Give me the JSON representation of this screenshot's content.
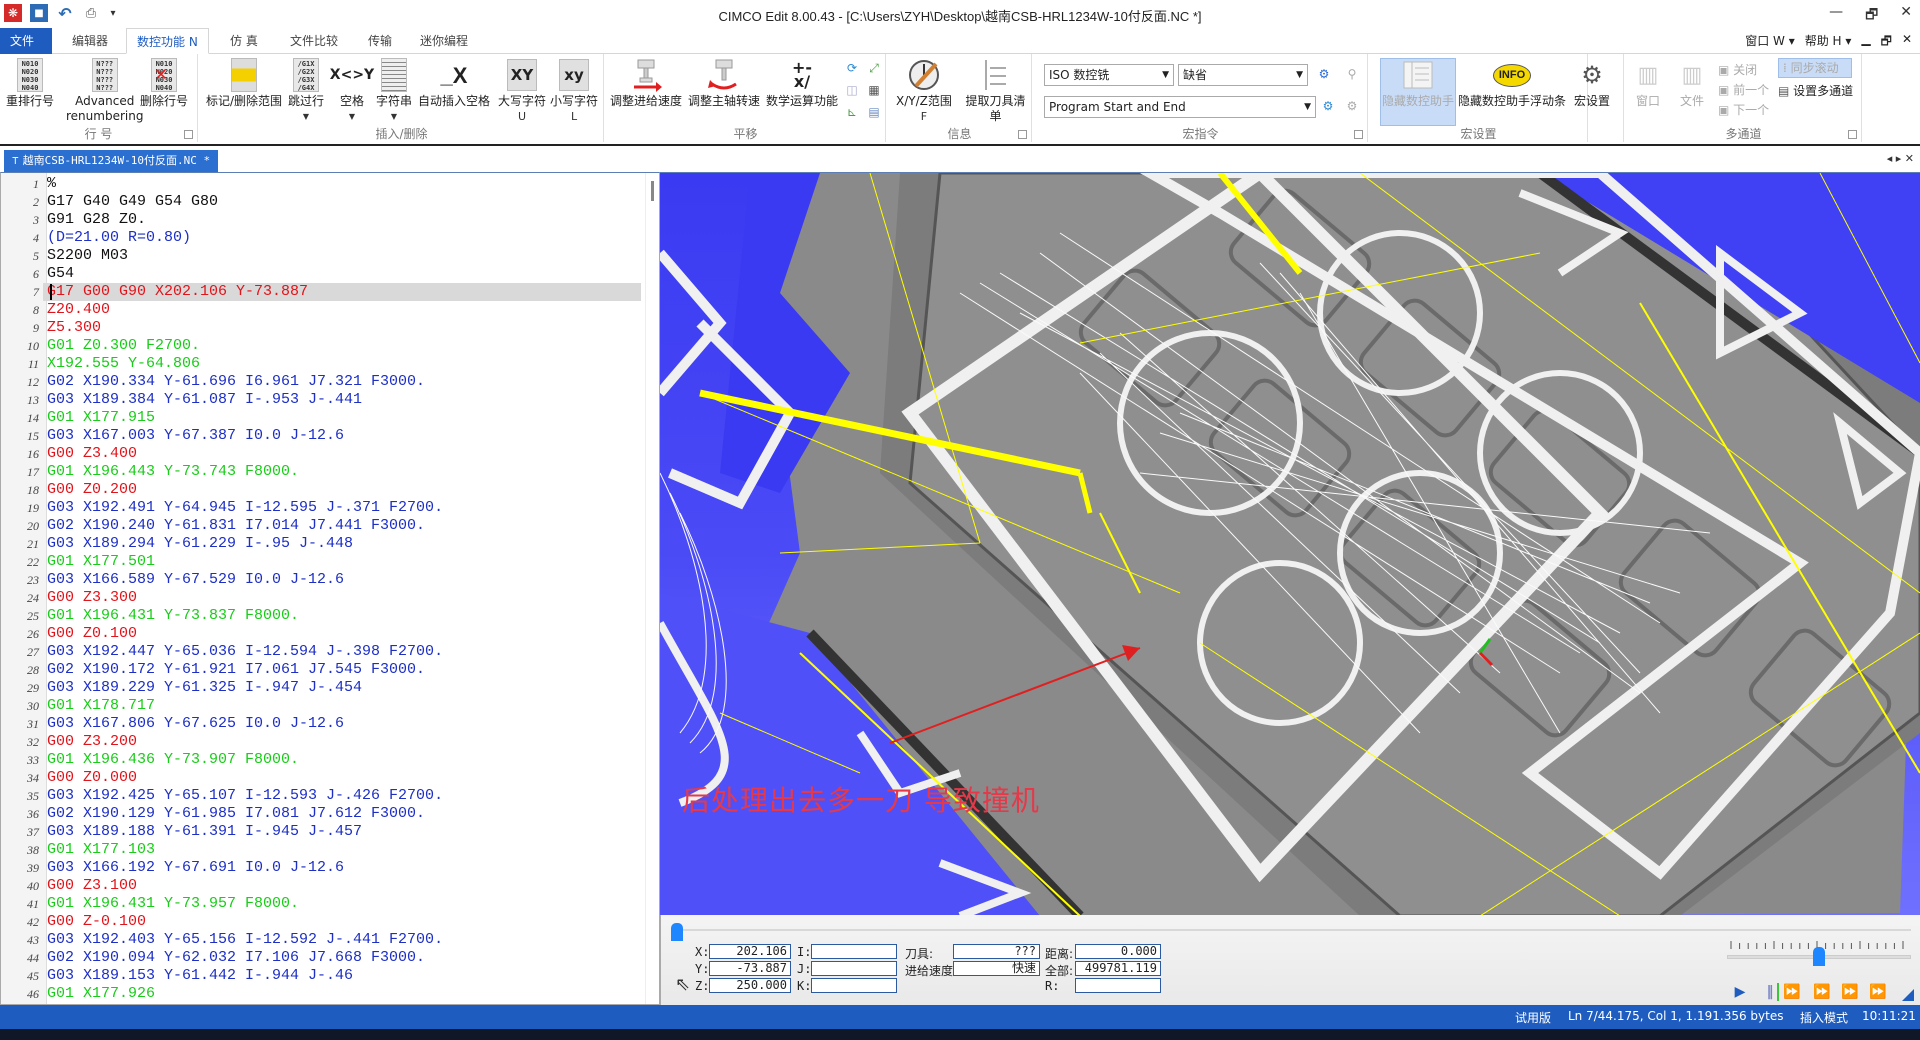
{
  "window": {
    "title": "CIMCO Edit 8.00.43 - [C:\\Users\\ZYH\\Desktop\\越南CSB-HRL1234W-10付反面.NC *]",
    "controls": {
      "minimize": "—",
      "restore": "🗗",
      "close": "✕"
    }
  },
  "quick_access": {
    "logo": "❋",
    "save": "■",
    "undo": "↶",
    "print": "⎙",
    "more": "▾"
  },
  "ribbon_tabs": [
    {
      "label": "文件 F",
      "state": "file"
    },
    {
      "label": "编辑器",
      "state": "normal"
    },
    {
      "label": "数控功能 N",
      "state": "active"
    },
    {
      "label": "仿 真",
      "state": "normal"
    },
    {
      "label": "文件比较",
      "state": "normal"
    },
    {
      "label": "传输",
      "state": "normal"
    },
    {
      "label": "迷你编程",
      "state": "normal"
    }
  ],
  "tabrow_right": {
    "window_menu": "窗口 W ▾",
    "help_menu": "帮助 H ▾",
    "mdi_min": "▁",
    "mdi_restore": "🗗",
    "mdi_close": "✕"
  },
  "ribbon": {
    "groups": {
      "line_numbers": {
        "label": "行 号",
        "buttons": {
          "renumber": {
            "label": "重排行号",
            "icon_text": "N010\nN020\nN030\nN040"
          },
          "advanced": {
            "label": "Advanced",
            "label2": "renumbering",
            "icon_text": "N???\nN???\nN???\nN???"
          },
          "delete": {
            "label": "删除行号",
            "icon_text": "N010\nN✕\nN040"
          }
        }
      },
      "insert_delete": {
        "label": "插入/删除",
        "buttons": {
          "mark_range": {
            "label": "标记/删除范围"
          },
          "skip_line": {
            "label": "跳过行",
            "icon_text": "/G1X\n/G2X\n/G3X\n/G4X"
          },
          "space": {
            "label": "空格",
            "icon_text": "X<>Y"
          },
          "string": {
            "label": "字符串"
          },
          "auto_space": {
            "label": "自动插入空格",
            "icon_text": "_X"
          },
          "uppercase": {
            "label": "大写字符",
            "sub": "U",
            "icon_text": "XY"
          },
          "lowercase": {
            "label": "小写字符",
            "sub": "L",
            "icon_text": "xy"
          }
        }
      },
      "translate": {
        "label": "平移",
        "buttons": {
          "adjust_feed": {
            "label": "调整进给速度"
          },
          "adjust_spindle": {
            "label": "调整主轴转速"
          },
          "math": {
            "label": "数学运算功能",
            "icon_text": "+-\nx/"
          }
        }
      },
      "info": {
        "label": "信息",
        "buttons": {
          "xyz_range": {
            "label": "X/Y/Z范围",
            "sub": "F"
          },
          "tool_list": {
            "label": "提取刀具清单"
          }
        }
      },
      "macros": {
        "label": "宏指令",
        "machine_select": "ISO 数控铣",
        "default_select": "缺省",
        "macro_select": "Program Start and End"
      },
      "macro_settings": {
        "label": "宏设置",
        "buttons": {
          "hide_helper": {
            "label": "隐藏数控助手"
          },
          "hide_helper_float": {
            "label": "隐藏数控助手浮动条",
            "icon_text": "INFO"
          },
          "macro_setup": {
            "label": "宏设置"
          }
        }
      },
      "multichannel": {
        "label": "多通道",
        "buttons": {
          "window": {
            "label": "窗口"
          },
          "file": {
            "label": "文件"
          },
          "close": {
            "label": "关闭"
          },
          "previous": {
            "label": "前一个"
          },
          "next": {
            "label": "下一个"
          },
          "sync_scroll": {
            "label": "同步滚动"
          },
          "setup_multichannel": {
            "label": "设置多通道"
          }
        }
      }
    }
  },
  "document_tab": {
    "label": "越南CSB-HRL1234W-10付反面.NC *",
    "nav": "◂ ▸ ✕"
  },
  "editor": {
    "current_line": 7,
    "lines": [
      {
        "n": "1",
        "text": "%",
        "color": "black"
      },
      {
        "n": "2",
        "text": "G17 G40 G49 G54 G80",
        "color": "black"
      },
      {
        "n": "3",
        "text": "G91 G28 Z0.",
        "color": "black"
      },
      {
        "n": "4",
        "text": "(D=21.00 R=0.80)",
        "color": "blue"
      },
      {
        "n": "5",
        "text": "S2200 M03",
        "color": "black"
      },
      {
        "n": "6",
        "text": "G54",
        "color": "black"
      },
      {
        "n": "7",
        "text": "G17 G00 G90 X202.106 Y-73.887",
        "color": "red"
      },
      {
        "n": "8",
        "text": "Z20.400",
        "color": "red"
      },
      {
        "n": "9",
        "text": "Z5.300",
        "color": "red"
      },
      {
        "n": "10",
        "text": "G01 Z0.300 F2700.",
        "color": "green"
      },
      {
        "n": "11",
        "text": "X192.555 Y-64.806",
        "color": "green"
      },
      {
        "n": "12",
        "text": "G02 X190.334 Y-61.696 I6.961 J7.321 F3000.",
        "color": "blue"
      },
      {
        "n": "13",
        "text": "G03 X189.384 Y-61.087 I-.953 J-.441",
        "color": "blue"
      },
      {
        "n": "14",
        "text": "G01 X177.915",
        "color": "green"
      },
      {
        "n": "15",
        "text": "G03 X167.003 Y-67.387 I0.0 J-12.6",
        "color": "blue"
      },
      {
        "n": "16",
        "text": "G00 Z3.400",
        "color": "red"
      },
      {
        "n": "17",
        "text": "G01 X196.443 Y-73.743 F8000.",
        "color": "green"
      },
      {
        "n": "18",
        "text": "G00 Z0.200",
        "color": "red"
      },
      {
        "n": "19",
        "text": "G03 X192.491 Y-64.945 I-12.595 J-.371 F2700.",
        "color": "blue"
      },
      {
        "n": "20",
        "text": "G02 X190.240 Y-61.831 I7.014 J7.441 F3000.",
        "color": "blue"
      },
      {
        "n": "21",
        "text": "G03 X189.294 Y-61.229 I-.95 J-.448",
        "color": "blue"
      },
      {
        "n": "22",
        "text": "G01 X177.501",
        "color": "green"
      },
      {
        "n": "23",
        "text": "G03 X166.589 Y-67.529 I0.0 J-12.6",
        "color": "blue"
      },
      {
        "n": "24",
        "text": "G00 Z3.300",
        "color": "red"
      },
      {
        "n": "25",
        "text": "G01 X196.431 Y-73.837 F8000.",
        "color": "green"
      },
      {
        "n": "26",
        "text": "G00 Z0.100",
        "color": "red"
      },
      {
        "n": "27",
        "text": "G03 X192.447 Y-65.036 I-12.594 J-.398 F2700.",
        "color": "blue"
      },
      {
        "n": "28",
        "text": "G02 X190.172 Y-61.921 I7.061 J7.545 F3000.",
        "color": "blue"
      },
      {
        "n": "29",
        "text": "G03 X189.229 Y-61.325 I-.947 J-.454",
        "color": "blue"
      },
      {
        "n": "30",
        "text": "G01 X178.717",
        "color": "green"
      },
      {
        "n": "31",
        "text": "G03 X167.806 Y-67.625 I0.0 J-12.6",
        "color": "blue"
      },
      {
        "n": "32",
        "text": "G00 Z3.200",
        "color": "red"
      },
      {
        "n": "33",
        "text": "G01 X196.436 Y-73.907 F8000.",
        "color": "green"
      },
      {
        "n": "34",
        "text": "G00 Z0.000",
        "color": "red"
      },
      {
        "n": "35",
        "text": "G03 X192.425 Y-65.107 I-12.593 J-.426 F2700.",
        "color": "blue"
      },
      {
        "n": "36",
        "text": "G02 X190.129 Y-61.985 I7.081 J7.612 F3000.",
        "color": "blue"
      },
      {
        "n": "37",
        "text": "G03 X189.188 Y-61.391 I-.945 J-.457",
        "color": "blue"
      },
      {
        "n": "38",
        "text": "G01 X177.103",
        "color": "green"
      },
      {
        "n": "39",
        "text": "G03 X166.192 Y-67.691 I0.0 J-12.6",
        "color": "blue"
      },
      {
        "n": "40",
        "text": "G00 Z3.100",
        "color": "red"
      },
      {
        "n": "41",
        "text": "G01 X196.431 Y-73.957 F8000.",
        "color": "green"
      },
      {
        "n": "42",
        "text": "G00 Z-0.100",
        "color": "red"
      },
      {
        "n": "43",
        "text": "G03 X192.403 Y-65.156 I-12.592 J-.441 F2700.",
        "color": "blue"
      },
      {
        "n": "44",
        "text": "G02 X190.094 Y-62.032 I7.106 J7.668 F3000.",
        "color": "blue"
      },
      {
        "n": "45",
        "text": "G03 X189.153 Y-61.442 I-.944 J-.46",
        "color": "blue"
      },
      {
        "n": "46",
        "text": "G01 X177.926",
        "color": "green"
      }
    ]
  },
  "viewport": {
    "annotation": "后处理出去多一刀 导致撞机",
    "annotation_color": "#e5394a",
    "background": "#4040f4",
    "toolpath_rapid_color": "#ffff00",
    "toolpath_feed_color": "#f0f0f0",
    "stock_color": "#8a8a8a"
  },
  "sim_panel": {
    "progress_fraction": 0.0,
    "speed_fraction": 0.5,
    "labels": {
      "x": "X:",
      "y": "Y:",
      "z": "Z:",
      "i": "I:",
      "j": "J:",
      "k": "K:",
      "tool": "刀具:",
      "feed": "进给速度:",
      "distance": "距离:",
      "total": "全部:",
      "r": "R:"
    },
    "values": {
      "x": "202.106",
      "y": "-73.887",
      "z": "250.000",
      "i": "",
      "j": "",
      "k": "",
      "tool": "???",
      "feed": "快速",
      "distance": "0.000",
      "total": "499781.119",
      "r": ""
    },
    "buttons": {
      "play": "▶",
      "pause": "‖",
      "step_forward": "⏩",
      "to_point": "⏩",
      "to_z": "⏩",
      "to_tool": "⏩"
    }
  },
  "statusbar": {
    "edition": "试用版",
    "position": "Ln 7/44.175, Col 1, 1.191.356 bytes",
    "mode": "插入模式",
    "time": "10:11:21"
  }
}
